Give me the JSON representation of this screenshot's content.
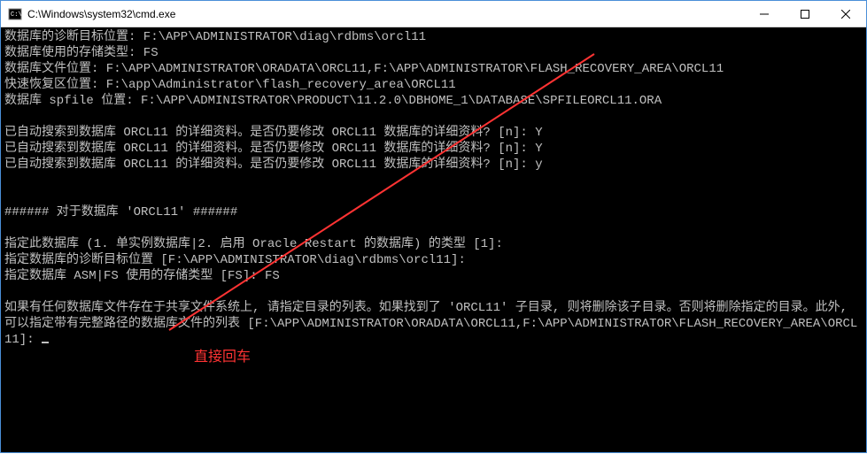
{
  "window": {
    "title": "C:\\Windows\\system32\\cmd.exe"
  },
  "terminal": {
    "lines": [
      "数据库的诊断目标位置: F:\\APP\\ADMINISTRATOR\\diag\\rdbms\\orcl11",
      "数据库使用的存储类型: FS",
      "数据库文件位置: F:\\APP\\ADMINISTRATOR\\ORADATA\\ORCL11,F:\\APP\\ADMINISTRATOR\\FLASH_RECOVERY_AREA\\ORCL11",
      "快速恢复区位置: F:\\app\\Administrator\\flash_recovery_area\\ORCL11",
      "数据库 spfile 位置: F:\\APP\\ADMINISTRATOR\\PRODUCT\\11.2.0\\DBHOME_1\\DATABASE\\SPFILEORCL11.ORA",
      "",
      "已自动搜索到数据库 ORCL11 的详细资料。是否仍要修改 ORCL11 数据库的详细资料? [n]: Y",
      "已自动搜索到数据库 ORCL11 的详细资料。是否仍要修改 ORCL11 数据库的详细资料? [n]: Y",
      "已自动搜索到数据库 ORCL11 的详细资料。是否仍要修改 ORCL11 数据库的详细资料? [n]: y",
      "",
      "",
      "###### 对于数据库 'ORCL11' ######",
      "",
      "指定此数据库 (1. 单实例数据库|2. 启用 Oracle Restart 的数据库) 的类型 [1]:",
      "指定数据库的诊断目标位置 [F:\\APP\\ADMINISTRATOR\\diag\\rdbms\\orcl11]:",
      "指定数据库 ASM|FS 使用的存储类型 [FS]: FS",
      "",
      "如果有任何数据库文件存在于共享文件系统上, 请指定目录的列表。如果找到了 'ORCL11' 子目录, 则将删除该子目录。否则将删除指定的目录。此外, 可以指定带有完整路径的数据库文件的列表 [F:\\APP\\ADMINISTRATOR\\ORADATA\\ORCL11,F:\\APP\\ADMINISTRATOR\\FLASH_RECOVERY_AREA\\ORCL11]: "
    ]
  },
  "annotation": {
    "text": "直接回车",
    "color": "#ff3333"
  }
}
